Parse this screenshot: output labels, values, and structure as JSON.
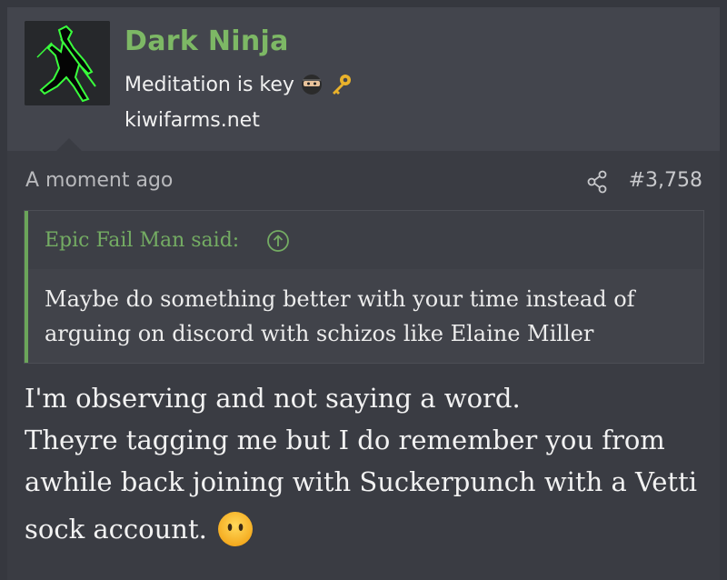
{
  "user": {
    "name": "Dark Ninja",
    "title": "Meditation is key",
    "title_emojis": [
      "ninja-emoji",
      "key-emoji"
    ],
    "site": "kiwifarms.net",
    "name_color": "#7db865"
  },
  "post": {
    "time": "A moment ago",
    "number": "#3,758",
    "share_icon": "share-icon",
    "body_lines": [
      "I'm observing and not saying a word.",
      "Theyre tagging me but I do remember you from",
      "awhile back joining with Suckerpunch with a Vetti",
      "sock account."
    ],
    "trailing_emoji": "no-mouth-face-emoji"
  },
  "quote": {
    "author": "Epic Fail Man said:",
    "expand_icon": "arrow-up-circle-icon",
    "text": "Maybe do something better with your time instead of arguing on discord with schizos like Elaine Miller",
    "accent": "#6ba55a"
  }
}
